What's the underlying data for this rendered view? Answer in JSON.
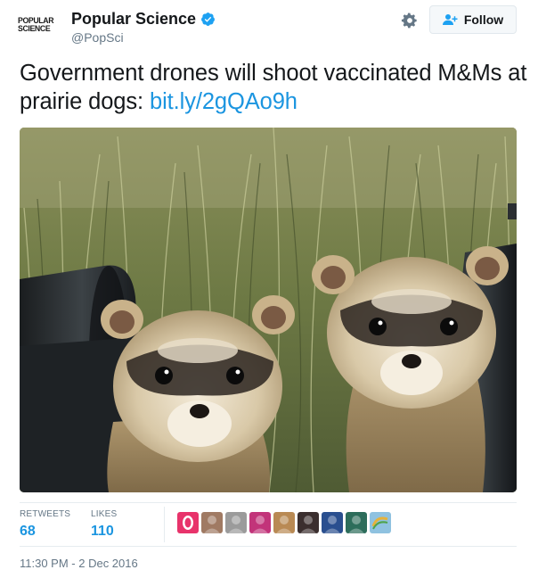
{
  "account": {
    "logo_line1": "POPULAR",
    "logo_line2": "SCIENCE",
    "display_name": "Popular Science",
    "handle": "@PopSci",
    "verified": true,
    "verified_icon": "verified-badge-icon",
    "verified_color": "#1da1f2"
  },
  "actions": {
    "settings_icon": "gear-icon",
    "follow_icon": "add-person-icon",
    "follow_label": "Follow"
  },
  "tweet": {
    "text": "Government drones will shoot vaccinated M&Ms at prairie dogs: ",
    "link_text": "bit.ly/2gQAo9h",
    "link_color": "#1b95e0"
  },
  "photo": {
    "subject": "two black-footed ferrets peeking out of black pipes in grass"
  },
  "stats": {
    "retweets_label": "RETWEETS",
    "retweets_value": "68",
    "likes_label": "LIKES",
    "likes_value": "110"
  },
  "likers": [
    {
      "icon": "liker-avatar",
      "color": "#e8336b"
    },
    {
      "icon": "liker-avatar",
      "color": "#a07a63"
    },
    {
      "icon": "liker-avatar",
      "color": "#9b9b9b"
    },
    {
      "icon": "liker-avatar",
      "color": "#c2347a"
    },
    {
      "icon": "liker-avatar",
      "color": "#b98a54"
    },
    {
      "icon": "liker-avatar",
      "color": "#3b2f2f"
    },
    {
      "icon": "liker-avatar",
      "color": "#2a4f8f"
    },
    {
      "icon": "liker-avatar",
      "color": "#2d6d5b"
    },
    {
      "icon": "liker-avatar",
      "color": "#8fc2e0"
    }
  ],
  "meta": {
    "timestamp": "11:30 PM - 2 Dec 2016"
  }
}
